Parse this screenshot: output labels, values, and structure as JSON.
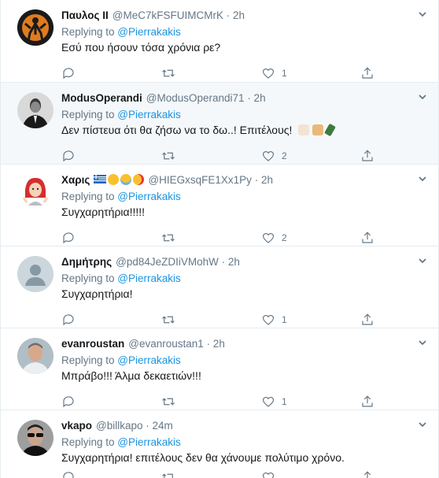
{
  "tweets": [
    {
      "name": "Παυλος ΙΙ",
      "handle": "@MeC7kFSFUIMCMrK",
      "time": "· 2h",
      "reply_prefix": "Replying to ",
      "reply_to": "@Pierrakakis",
      "text": "Εσύ που ήσουν τόσα χρόνια ρε?",
      "reply_count": "",
      "retweet_count": "",
      "like_count": "1",
      "avatar": "silhouette-avatar"
    },
    {
      "name": "ModusOperandi",
      "handle": "@ModusOperandi71",
      "time": "· 2h",
      "reply_prefix": "Replying to ",
      "reply_to": "@Pierrakakis",
      "text": "Δεν πίστευα ότι θα ζήσω να το δω..! Επιτέλους!",
      "reply_count": "",
      "retweet_count": "",
      "like_count": "2",
      "avatar": "man-in-suit-avatar"
    },
    {
      "name": "Χαρις",
      "handle": "@HIEGxsqFE1Xx1Py",
      "time": "· 2h",
      "reply_prefix": "Replying to ",
      "reply_to": "@Pierrakakis",
      "text": "Συγχαρητήρια!!!!!",
      "reply_count": "",
      "retweet_count": "",
      "like_count": "2",
      "avatar": "red-hair-girl-avatar"
    },
    {
      "name": "Δημήτρης",
      "handle": "@pd84JeZDIiVMohW",
      "time": "· 2h",
      "reply_prefix": "Replying to ",
      "reply_to": "@Pierrakakis",
      "text": "Συγχαρητήρια!",
      "reply_count": "",
      "retweet_count": "",
      "like_count": "1",
      "avatar": "default-avatar"
    },
    {
      "name": "evanroustan",
      "handle": "@evanroustan1",
      "time": "· 2h",
      "reply_prefix": "Replying to ",
      "reply_to": "@Pierrakakis",
      "text": "Μπράβο!!! Άλμα δεκαετιών!!!",
      "reply_count": "",
      "retweet_count": "",
      "like_count": "1",
      "avatar": "man-photo-avatar"
    },
    {
      "name": "vkapo",
      "handle": "@billkapo",
      "time": "· 24m",
      "reply_prefix": "Replying to ",
      "reply_to": "@Pierrakakis",
      "text": "Συγχαρητήρια! επιτέλους δεν θα χάνουμε πολύτιμο χρόνο.",
      "reply_count": "",
      "retweet_count": "",
      "like_count": "",
      "avatar": "man-sunglasses-avatar"
    }
  ],
  "colors": {
    "link": "#1b95e0",
    "muted": "#657786",
    "highlight_bg": "#f5f8fa",
    "border": "#e6ecf0"
  }
}
